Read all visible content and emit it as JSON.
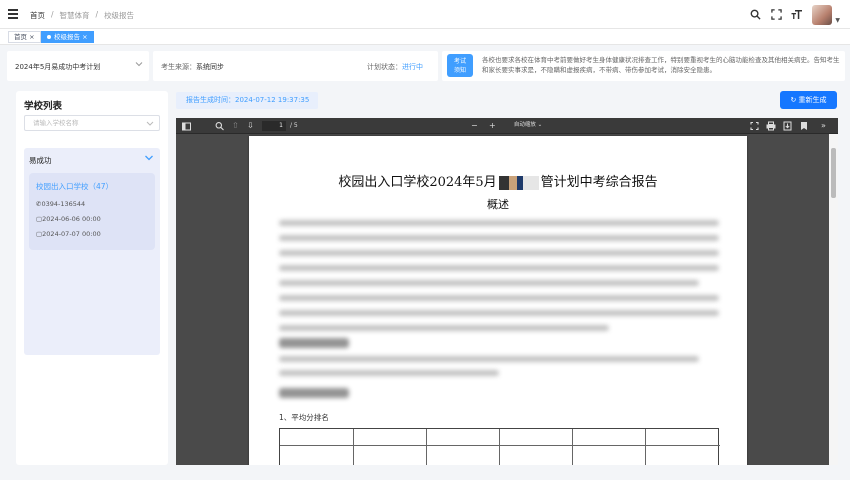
{
  "breadcrumb": [
    "首页",
    "/",
    "智慧体育",
    "/",
    "校级报告"
  ],
  "tags": [
    {
      "label": "首页",
      "close": "×"
    },
    {
      "label": "校级报告",
      "close": "×"
    }
  ],
  "filter": {
    "plan": "2024年5月易成功中考计划",
    "source_label": "考生来源：",
    "source_value": "系统同步",
    "status_label": "计划状态：",
    "status_value": "进行中",
    "badge_line1": "考试",
    "badge_line2": "须知",
    "notice": "各校也要求各校在体育中考前要做好考生身体健康状况排查工作，特别要重视考生的心脑功能检查及其他相关病史。告知考生和家长要实事求是，不隐瞒和虚报疾病，不带病、带伤参加考试，消除安全隐患。"
  },
  "sidebar": {
    "title": "学校列表",
    "search_placeholder": "请输入学校名称",
    "group_name": "易成功",
    "school": {
      "name": "校园出入口学校（47）",
      "phone": "0394-136544",
      "start": "2024-06-06 00:00",
      "end": "2024-07-07 00:00"
    }
  },
  "report": {
    "gen_time": "报告生成时间：2024-07-12 19:37:35",
    "regen_label": "重新生成"
  },
  "viewer": {
    "page_current": "1",
    "page_total": "/ 5",
    "zoom": "自动缩放",
    "doc_title_left": "校园出入口学校2024年5月",
    "doc_title_right": "管计划中考综合报告",
    "doc_subtitle": "概述",
    "section_1": "1、平均分排名"
  }
}
